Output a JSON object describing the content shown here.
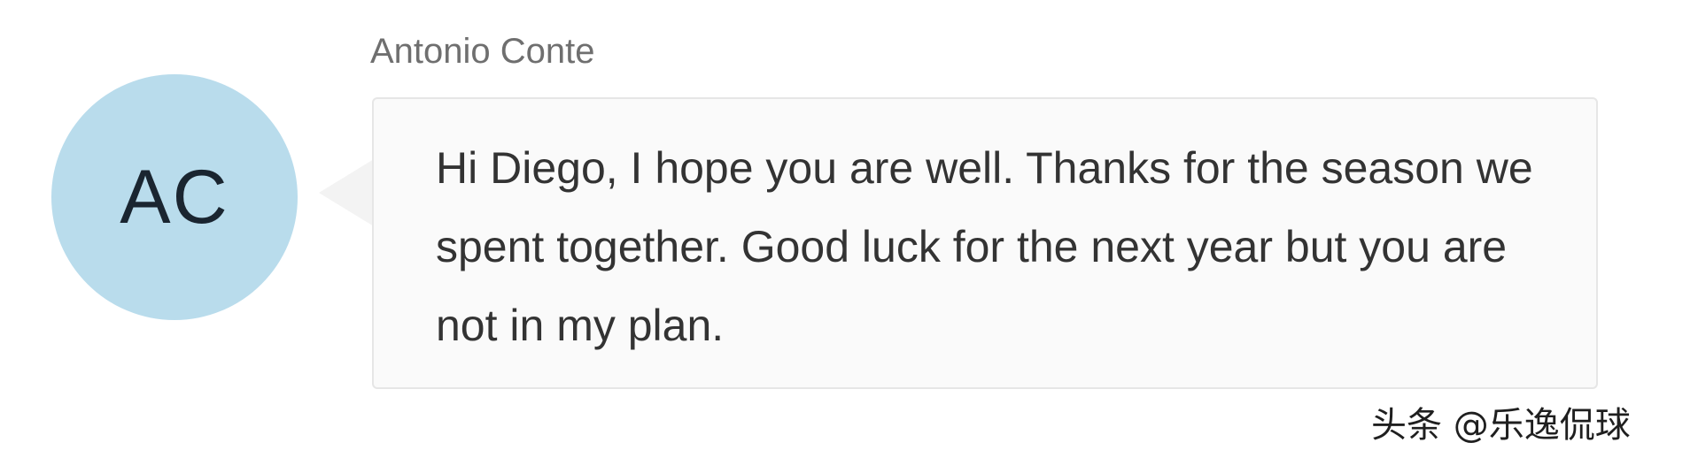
{
  "avatar": {
    "initials": "AC",
    "color": "#b9dcec"
  },
  "message": {
    "sender": "Antonio Conte",
    "text": "Hi Diego, I hope you are well. Thanks for the season we spent together. Good luck for the next year but you are not in my plan."
  },
  "watermark": {
    "text": "头条 @乐逸侃球"
  }
}
